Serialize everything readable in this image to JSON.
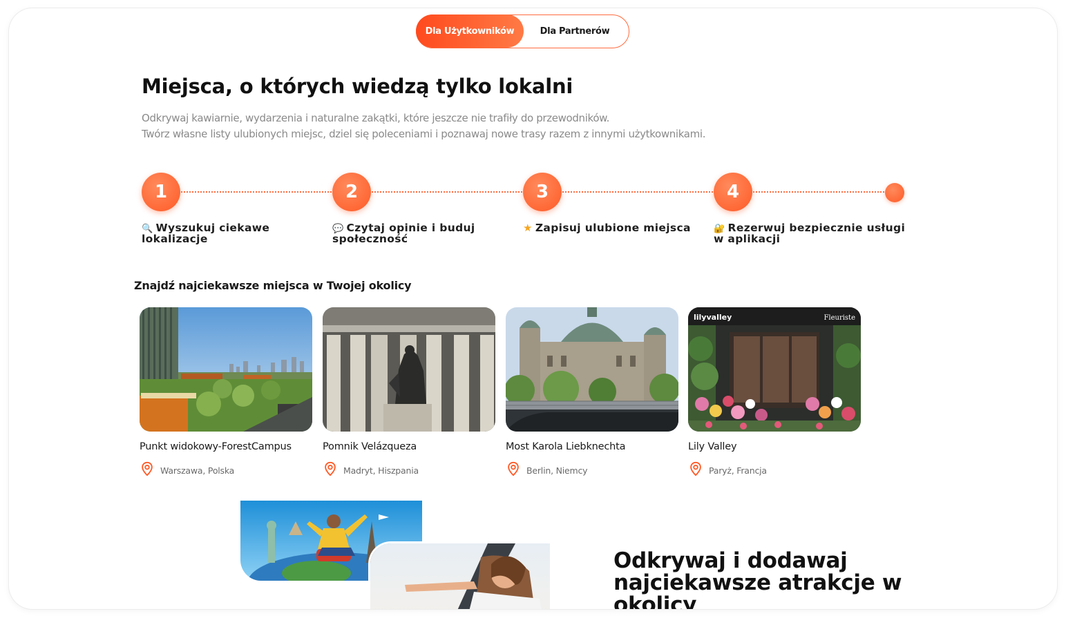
{
  "toggle": {
    "users_label": "Dla Użytkowników",
    "partners_label": "Dla Partnerów"
  },
  "hero": {
    "title": "Miejsca, o których wiedzą tylko lokalni",
    "desc_line1": "Odkrywaj kawiarnie, wydarzenia i naturalne zakątki, które jeszcze nie trafiły do przewodników.",
    "desc_line2": "Twórz własne listy ulubionych miejsc, dziel się poleceniami i poznawaj nowe trasy razem z innymi użytkownikami."
  },
  "steps": [
    {
      "number": "1",
      "icon": "magnifier-emoji",
      "emoji": "🔍",
      "label": "Wyszukuj ciekawe lokalizacje"
    },
    {
      "number": "2",
      "icon": "speech-bubble-emoji",
      "emoji": "💬",
      "label": "Czytaj opinie i buduj społeczność"
    },
    {
      "number": "3",
      "icon": "star-emoji",
      "emoji": "★",
      "label": "Zapisuj ulubione miejsca"
    },
    {
      "number": "4",
      "icon": "lock-emoji",
      "emoji": "🔐",
      "label": "Rezerwuj bezpiecznie usługi w aplikacji"
    }
  ],
  "places_section": {
    "title": "Znajdź najciekawsze miejsca w Twojej okolicy",
    "cards": [
      {
        "name": "Punkt widokowy-ForestCampus",
        "location": "Warszawa, Polska"
      },
      {
        "name": "Pomnik Velázqueza",
        "location": "Madryt, Hiszpania"
      },
      {
        "name": "Most Karola Liebknechta",
        "location": "Berlin, Niemcy"
      },
      {
        "name": "Lily Valley",
        "location": "Paryż, Francja",
        "sign_left": "lilyvalley",
        "sign_right": "Fleuriste"
      }
    ]
  },
  "promo": {
    "title": "Odkrywaj i dodawaj najciekawsze atrakcje w okolicy"
  },
  "colors": {
    "accent": "#ff5a26",
    "accent_light": "#ff8a5c",
    "text_dark": "#111111",
    "text_muted": "#8a8a8a"
  }
}
